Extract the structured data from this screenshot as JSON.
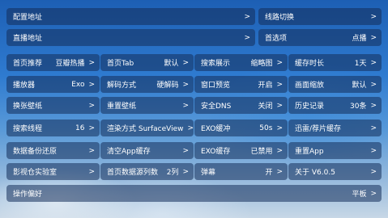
{
  "row1": {
    "config_address": {
      "label": "配置地址",
      "arrow": ">"
    },
    "line_switch": {
      "label": "线路切换",
      "arrow": ">"
    }
  },
  "row2": {
    "live_address": {
      "label": "直播地址",
      "arrow": ">"
    },
    "preferred": {
      "label": "首选项",
      "value": "点播",
      "arrow": ">"
    }
  },
  "grid": [
    [
      {
        "label": "首页推荐",
        "value": "豆瓣热播",
        "arrow": ">"
      },
      {
        "label": "首页Tab",
        "value": "默认",
        "arrow": ">"
      },
      {
        "label": "搜索展示",
        "value": "缩略图",
        "arrow": ">"
      },
      {
        "label": "缓存时长",
        "value": "1天",
        "arrow": ">"
      }
    ],
    [
      {
        "label": "播放器",
        "value": "Exo",
        "arrow": ">"
      },
      {
        "label": "解码方式",
        "value": "硬解码",
        "arrow": ">"
      },
      {
        "label": "窗口预览",
        "value": "开启",
        "arrow": ">"
      },
      {
        "label": "画面缩放",
        "value": "默认",
        "arrow": ">"
      }
    ],
    [
      {
        "label": "换张壁纸",
        "value": "",
        "arrow": ">"
      },
      {
        "label": "重置壁纸",
        "value": "",
        "arrow": ">"
      },
      {
        "label": "安全DNS",
        "value": "关闭",
        "arrow": ">"
      },
      {
        "label": "历史记录",
        "value": "30条",
        "arrow": ">"
      }
    ],
    [
      {
        "label": "搜索线程",
        "value": "16",
        "arrow": ">"
      },
      {
        "label": "渲染方式 SurfaceView",
        "value": "",
        "arrow": ">"
      },
      {
        "label": "EXO缓冲",
        "value": "50s",
        "arrow": ">"
      },
      {
        "label": "迅雷/荐片缓存",
        "value": "",
        "arrow": ">"
      }
    ],
    [
      {
        "label": "数据备份还原",
        "value": "",
        "arrow": ">"
      },
      {
        "label": "清空App缓存",
        "value": "",
        "arrow": ">"
      },
      {
        "label": "EXO缓存",
        "value": "已禁用",
        "arrow": ">"
      },
      {
        "label": "重置App",
        "value": "",
        "arrow": ">"
      }
    ],
    [
      {
        "label": "影视仓实验室",
        "value": "",
        "arrow": ">"
      },
      {
        "label": "首页数据源列数",
        "value": "2列",
        "arrow": ">"
      },
      {
        "label": "弹幕",
        "value": "开",
        "arrow": ">"
      },
      {
        "label": "关于 V6.0.5",
        "value": "",
        "arrow": ">"
      }
    ]
  ],
  "operation": {
    "label": "操作偏好",
    "value": "平板",
    "arrow": ">"
  }
}
